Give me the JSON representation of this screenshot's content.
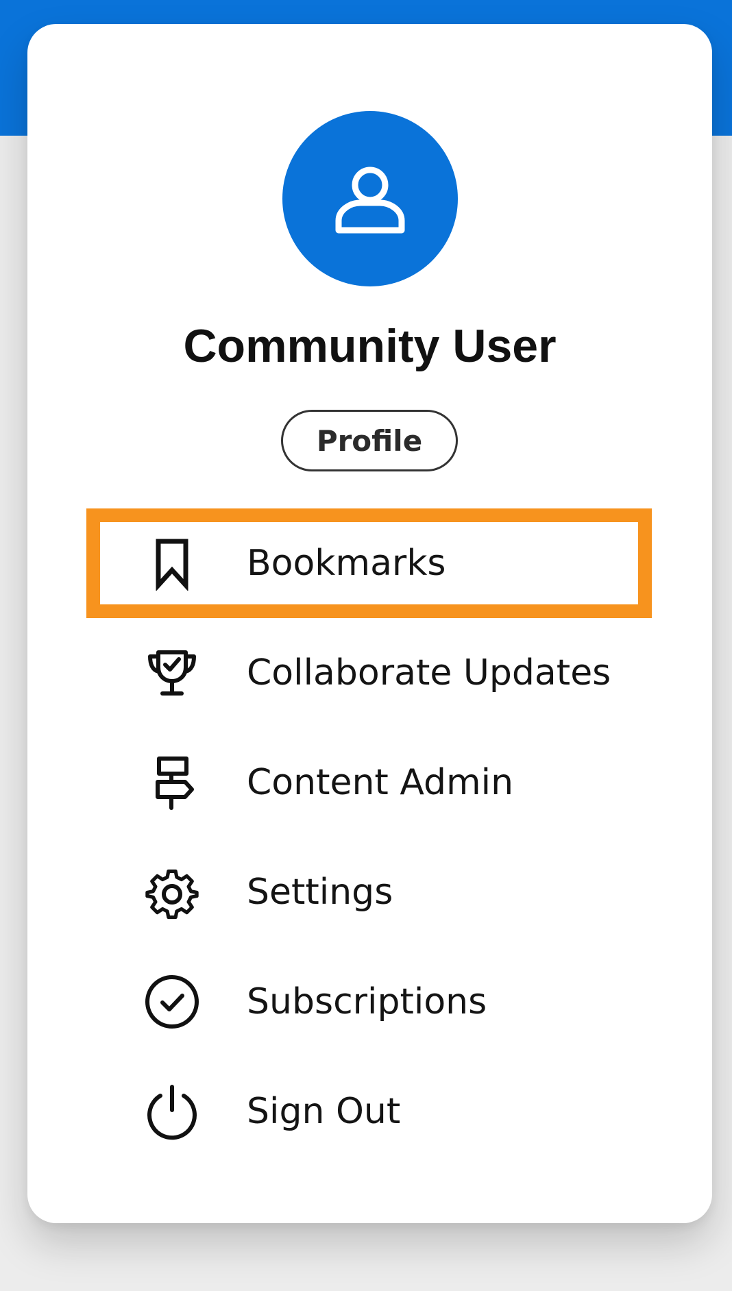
{
  "colors": {
    "brand_blue": "#0a73d9",
    "highlight_orange": "#f7931e",
    "text": "#141414"
  },
  "user": {
    "avatar_icon": "user-icon",
    "name": "Community User",
    "profile_label": "Profile"
  },
  "menu": {
    "items": [
      {
        "label": "Bookmarks",
        "icon": "bookmark-icon",
        "highlighted": true
      },
      {
        "label": "Collaborate Updates",
        "icon": "trophy-icon",
        "highlighted": false
      },
      {
        "label": "Content Admin",
        "icon": "signpost-icon",
        "highlighted": false
      },
      {
        "label": "Settings",
        "icon": "gear-icon",
        "highlighted": false
      },
      {
        "label": "Subscriptions",
        "icon": "check-circle-icon",
        "highlighted": false
      },
      {
        "label": "Sign Out",
        "icon": "power-icon",
        "highlighted": false
      }
    ]
  }
}
